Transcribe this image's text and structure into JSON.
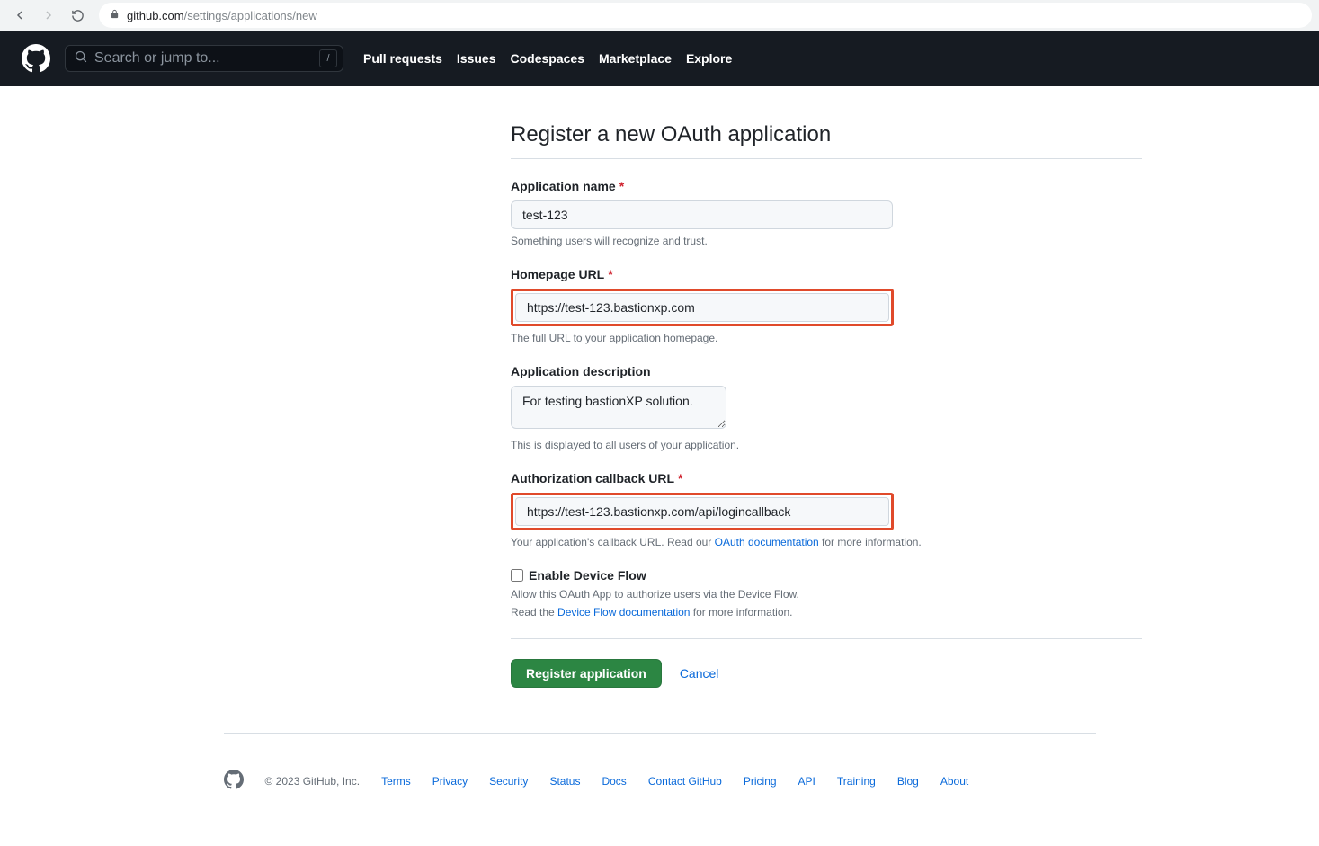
{
  "browser": {
    "url_host": "github.com",
    "url_path": "/settings/applications/new"
  },
  "header": {
    "search_placeholder": "Search or jump to...",
    "slash": "/",
    "nav": [
      "Pull requests",
      "Issues",
      "Codespaces",
      "Marketplace",
      "Explore"
    ]
  },
  "page": {
    "title": "Register a new OAuth application"
  },
  "form": {
    "app_name": {
      "label": "Application name",
      "value": "test-123",
      "help": "Something users will recognize and trust."
    },
    "homepage": {
      "label": "Homepage URL",
      "value": "https://test-123.bastionxp.com",
      "help": "The full URL to your application homepage."
    },
    "description": {
      "label": "Application description",
      "value": "For testing bastionXP solution.",
      "help": "This is displayed to all users of your application."
    },
    "callback": {
      "label": "Authorization callback URL",
      "value": "https://test-123.bastionxp.com/api/logincallback",
      "help_prefix": "Your application's callback URL. Read our ",
      "help_link": "OAuth documentation",
      "help_suffix": " for more information."
    },
    "device_flow": {
      "label": "Enable Device Flow",
      "help_line1": "Allow this OAuth App to authorize users via the Device Flow.",
      "help_line2_prefix": "Read the ",
      "help_line2_link": "Device Flow documentation",
      "help_line2_suffix": " for more information."
    },
    "buttons": {
      "submit": "Register application",
      "cancel": "Cancel"
    }
  },
  "footer": {
    "copyright": "© 2023 GitHub, Inc.",
    "links": [
      "Terms",
      "Privacy",
      "Security",
      "Status",
      "Docs",
      "Contact GitHub",
      "Pricing",
      "API",
      "Training",
      "Blog",
      "About"
    ]
  }
}
